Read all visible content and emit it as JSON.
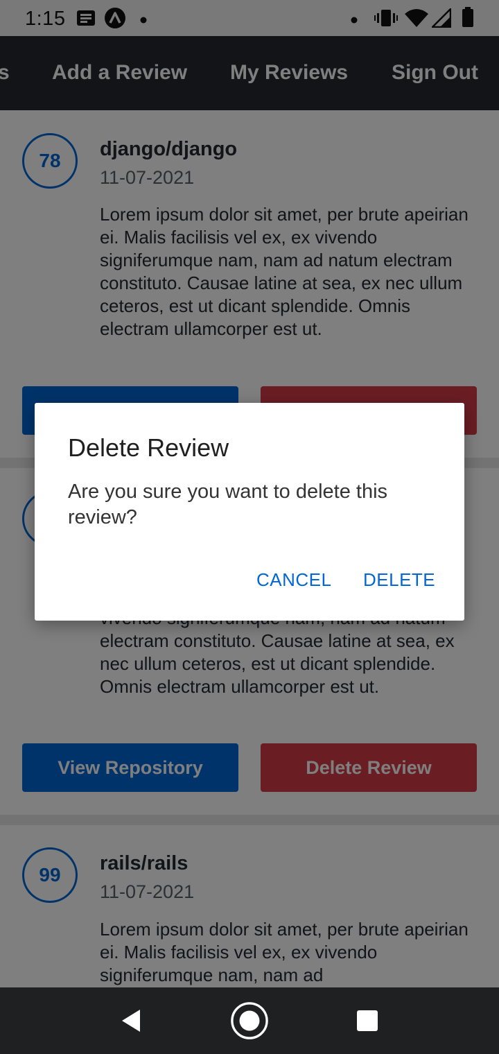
{
  "status_bar": {
    "time": "1:15"
  },
  "tabs": [
    {
      "label": "s"
    },
    {
      "label": "Add a Review"
    },
    {
      "label": "My Reviews"
    },
    {
      "label": "Sign Out"
    }
  ],
  "reviews": [
    {
      "rating": "78",
      "repo": "django/django",
      "date": "11-07-2021",
      "text": "Lorem ipsum dolor sit amet, per brute apeirian ei. Malis facilisis vel ex, ex vivendo signiferumque nam, nam ad natum electram constituto. Causae latine at sea, ex nec ullum ceteros, est ut dicant splendide. Omnis electram ullamcorper est ut."
    },
    {
      "partial_text": "vivendo signiferumque nam, nam ad natum electram constituto. Causae latine at sea, ex nec ullum ceteros, est ut dicant splendide. Omnis electram ullamcorper est ut.",
      "view_label": "View Repository",
      "delete_label": "Delete Review"
    },
    {
      "rating": "99",
      "repo": "rails/rails",
      "date": "11-07-2021",
      "text": "Lorem ipsum dolor sit amet, per brute apeirian ei. Malis facilisis vel ex, ex vivendo signiferumque nam, nam ad"
    }
  ],
  "dialog": {
    "title": "Delete Review",
    "message": "Are you sure you want to delete this review?",
    "cancel": "CANCEL",
    "confirm": "DELETE"
  },
  "colors": {
    "primary": "#0366d6",
    "danger": "#d73a49",
    "tabbar": "#24292e"
  }
}
